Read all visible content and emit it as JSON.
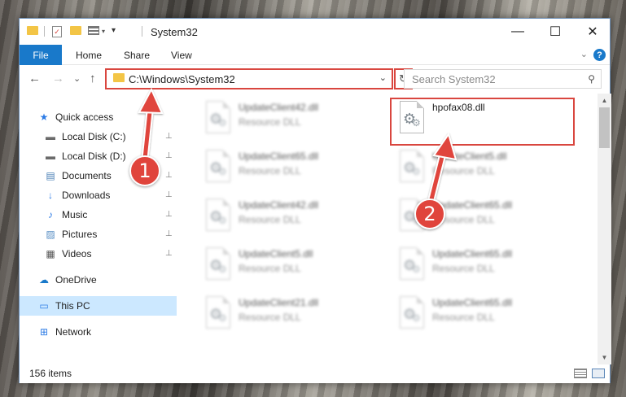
{
  "window": {
    "title": "System32",
    "minimize_glyph": "—",
    "maximize_glyph": "☐",
    "close_glyph": "✕"
  },
  "ribbon": {
    "tabs": [
      "File",
      "Home",
      "Share",
      "View"
    ],
    "help_glyph": "?",
    "collapse_glyph": "⌄"
  },
  "address": {
    "path": "C:\\Windows\\System32",
    "back_glyph": "←",
    "forward_glyph": "→",
    "recent_glyph": "⌄",
    "up_glyph": "↑",
    "dropdown_glyph": "⌄",
    "refresh_glyph": "↻"
  },
  "search": {
    "placeholder": "Search System32",
    "icon": "search-icon",
    "icon_glyph": "⚲"
  },
  "navpane": {
    "items": [
      {
        "label": "Quick access",
        "icon": "star-icon",
        "glyph": "★",
        "color": "#2c7be5",
        "pinned": false
      },
      {
        "label": "Local Disk (C:)",
        "icon": "drive-icon",
        "glyph": "▬",
        "color": "#6b6b6b",
        "pinned": true
      },
      {
        "label": "Local Disk (D:)",
        "icon": "drive-icon",
        "glyph": "▬",
        "color": "#6b6b6b",
        "pinned": true
      },
      {
        "label": "Documents",
        "icon": "documents-icon",
        "glyph": "▤",
        "color": "#4a7fb5",
        "pinned": true
      },
      {
        "label": "Downloads",
        "icon": "download-icon",
        "glyph": "↓",
        "color": "#2c7be5",
        "pinned": true
      },
      {
        "label": "Music",
        "icon": "music-icon",
        "glyph": "♪",
        "color": "#2c7be5",
        "pinned": true
      },
      {
        "label": "Pictures",
        "icon": "pictures-icon",
        "glyph": "▨",
        "color": "#5a8fc4",
        "pinned": true
      },
      {
        "label": "Videos",
        "icon": "videos-icon",
        "glyph": "▦",
        "color": "#555",
        "pinned": true
      },
      {
        "label": "OneDrive",
        "icon": "cloud-icon",
        "glyph": "☁",
        "color": "#1979ca",
        "pinned": false
      },
      {
        "label": "This PC",
        "icon": "computer-icon",
        "glyph": "▭",
        "color": "#2c7be5",
        "pinned": false,
        "selected": true
      },
      {
        "label": "Network",
        "icon": "network-icon",
        "glyph": "⊞",
        "color": "#2c7be5",
        "pinned": false
      }
    ],
    "pin_glyph": "📌"
  },
  "files": [
    {
      "name": "UpdateClient42.dll",
      "type": "Resource DLL",
      "blurred": true
    },
    {
      "name": "hpofax08.dll",
      "type": "",
      "blurred": false
    },
    {
      "name": "UpdateClient65.dll",
      "type": "Resource DLL",
      "blurred": true
    },
    {
      "name": "UpdateClient5.dll",
      "type": "Resource DLL",
      "blurred": true
    },
    {
      "name": "UpdateClient42.dll",
      "type": "Resource DLL",
      "blurred": true
    },
    {
      "name": "UpdateClient65.dll",
      "type": "Resource DLL",
      "blurred": true
    },
    {
      "name": "UpdateClient5.dll",
      "type": "Resource DLL",
      "blurred": true
    },
    {
      "name": "UpdateClient65.dll",
      "type": "Resource DLL",
      "blurred": true
    },
    {
      "name": "UpdateClient21.dll",
      "type": "Resource DLL",
      "blurred": true
    },
    {
      "name": "UpdateClient65.dll",
      "type": "Resource DLL",
      "blurred": true
    }
  ],
  "annotations": {
    "callout_1": "1",
    "callout_2": "2",
    "color": "#e0443c"
  },
  "status": {
    "item_count": "156 items"
  }
}
